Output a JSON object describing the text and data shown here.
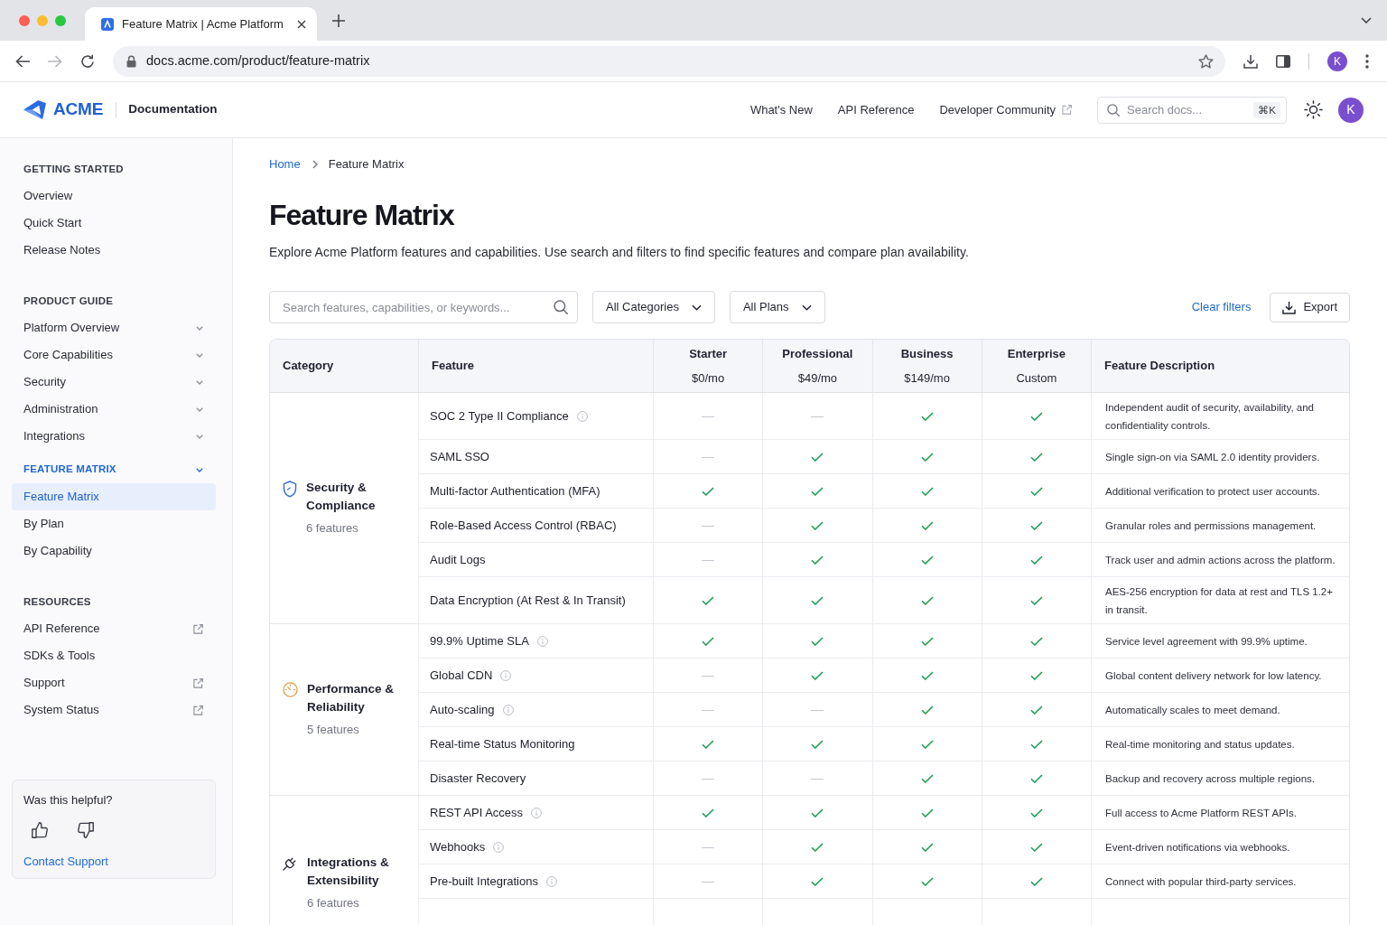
{
  "browser": {
    "tab": {
      "title": "Feature Matrix | Acme Platform",
      "selected": true
    },
    "url": "docs.acme.com/product/feature-matrix",
    "profile_initial": "K"
  },
  "header": {
    "logo": "ACME",
    "section": "Documentation",
    "nav": [
      {
        "label": "What's New",
        "external": false
      },
      {
        "label": "API Reference",
        "external": false
      },
      {
        "label": "Developer Community",
        "external": true
      }
    ],
    "search": {
      "placeholder": "Search docs...",
      "shortcut": "⌘K"
    },
    "avatar": "K"
  },
  "sidebar": {
    "sections": [
      {
        "title": "GETTING STARTED",
        "items": [
          {
            "label": "Overview",
            "kind": "link",
            "selected": false
          },
          {
            "label": "Quick Start",
            "kind": "link",
            "selected": false
          },
          {
            "label": "Release Notes",
            "kind": "link",
            "selected": false
          }
        ]
      },
      {
        "title": "PRODUCT GUIDE",
        "items": [
          {
            "label": "Platform Overview",
            "kind": "group",
            "expanded": false,
            "selected": false
          },
          {
            "label": "Core Capabilities",
            "kind": "group",
            "expanded": false,
            "selected": false
          },
          {
            "label": "Security",
            "kind": "group",
            "expanded": false,
            "selected": false
          },
          {
            "label": "Administration",
            "kind": "group",
            "expanded": false,
            "selected": false
          },
          {
            "label": "Integrations",
            "kind": "group",
            "expanded": false,
            "selected": false
          },
          {
            "label": "FEATURE MATRIX",
            "kind": "group",
            "expanded": true,
            "selected": false,
            "children": [
              {
                "label": "Feature Matrix",
                "kind": "link",
                "selected": true
              },
              {
                "label": "By Plan",
                "kind": "link",
                "selected": false
              },
              {
                "label": "By Capability",
                "kind": "link",
                "selected": false
              }
            ]
          }
        ]
      },
      {
        "title": "RESOURCES",
        "items": [
          {
            "label": "API Reference",
            "kind": "external",
            "selected": false
          },
          {
            "label": "SDKs & Tools",
            "kind": "link",
            "selected": false
          },
          {
            "label": "Support",
            "kind": "external",
            "selected": false
          },
          {
            "label": "System Status",
            "kind": "external",
            "selected": false
          }
        ]
      }
    ],
    "feedback": {
      "question": "Was this helpful?",
      "link": "Contact Support"
    }
  },
  "breadcrumb": [
    {
      "label": "Home",
      "kind": "link"
    },
    {
      "label": "Feature Matrix",
      "kind": "current"
    }
  ],
  "page": {
    "title": "Feature Matrix",
    "intro": "Explore Acme Platform features and capabilities. Use search and filters to find specific features and compare plan availability."
  },
  "toolbar": {
    "search": {
      "placeholder": "Search features, capabilities, or keywords..."
    },
    "filters": [
      {
        "label": "All Categories"
      },
      {
        "label": "All Plans"
      }
    ],
    "clear": "Clear filters",
    "export": "Export"
  },
  "table": {
    "columns": [
      {
        "label": "Category",
        "kind": "category"
      },
      {
        "label": "Feature",
        "kind": "feature"
      },
      {
        "label": "Starter",
        "kind": "plan",
        "price": "$0/mo"
      },
      {
        "label": "Professional",
        "kind": "plan",
        "price": "$49/mo"
      },
      {
        "label": "Business",
        "kind": "plan",
        "price": "$149/mo"
      },
      {
        "label": "Enterprise",
        "kind": "plan",
        "price": "Custom"
      },
      {
        "label": "Feature Description",
        "kind": "description"
      }
    ],
    "groups": [
      {
        "name": "Security & Compliance",
        "kind": "security",
        "count": "6 features",
        "features": [
          {
            "name": "SOC 2 Type II Compliance",
            "info": true,
            "plans": [
              false,
              false,
              true,
              true
            ],
            "description": "Independent audit of security, availability, and confidentiality controls."
          },
          {
            "name": "SAML SSO",
            "info": false,
            "plans": [
              false,
              true,
              true,
              true
            ],
            "description": "Single sign-on via SAML 2.0 identity providers."
          },
          {
            "name": "Multi-factor Authentication (MFA)",
            "info": false,
            "plans": [
              true,
              true,
              true,
              true
            ],
            "description": "Additional verification to protect user accounts."
          },
          {
            "name": "Role-Based Access Control (RBAC)",
            "info": false,
            "plans": [
              false,
              true,
              true,
              true
            ],
            "description": "Granular roles and permissions management."
          },
          {
            "name": "Audit Logs",
            "info": false,
            "plans": [
              false,
              true,
              true,
              true
            ],
            "description": "Track user and admin actions across the platform."
          },
          {
            "name": "Data Encryption (At Rest & In Transit)",
            "info": false,
            "plans": [
              true,
              true,
              true,
              true
            ],
            "description": "AES-256 encryption for data at rest and TLS 1.2+ in transit."
          }
        ]
      },
      {
        "name": "Performance & Reliability",
        "kind": "performance",
        "count": "5 features",
        "features": [
          {
            "name": "99.9% Uptime SLA",
            "info": true,
            "plans": [
              true,
              true,
              true,
              true
            ],
            "description": "Service level agreement with 99.9% uptime."
          },
          {
            "name": "Global CDN",
            "info": true,
            "plans": [
              false,
              true,
              true,
              true
            ],
            "description": "Global content delivery network for low latency."
          },
          {
            "name": "Auto-scaling",
            "info": true,
            "plans": [
              false,
              false,
              true,
              true
            ],
            "description": "Automatically scales to meet demand."
          },
          {
            "name": "Real-time Status Monitoring",
            "info": false,
            "plans": [
              true,
              true,
              true,
              true
            ],
            "description": "Real-time monitoring and status updates."
          },
          {
            "name": "Disaster Recovery",
            "info": false,
            "plans": [
              false,
              false,
              true,
              true
            ],
            "description": "Backup and recovery across multiple regions."
          }
        ]
      },
      {
        "name": "Integrations & Extensibility",
        "kind": "integrations",
        "count": "6 features",
        "features": [
          {
            "name": "REST API Access",
            "info": true,
            "plans": [
              true,
              true,
              true,
              true
            ],
            "description": "Full access to Acme Platform REST APIs."
          },
          {
            "name": "Webhooks",
            "info": true,
            "plans": [
              false,
              true,
              true,
              true
            ],
            "description": "Event-driven notifications via webhooks."
          },
          {
            "name": "Pre-built Integrations",
            "info": true,
            "plans": [
              false,
              true,
              true,
              true
            ],
            "description": "Connect with popular third-party services."
          }
        ]
      }
    ]
  }
}
